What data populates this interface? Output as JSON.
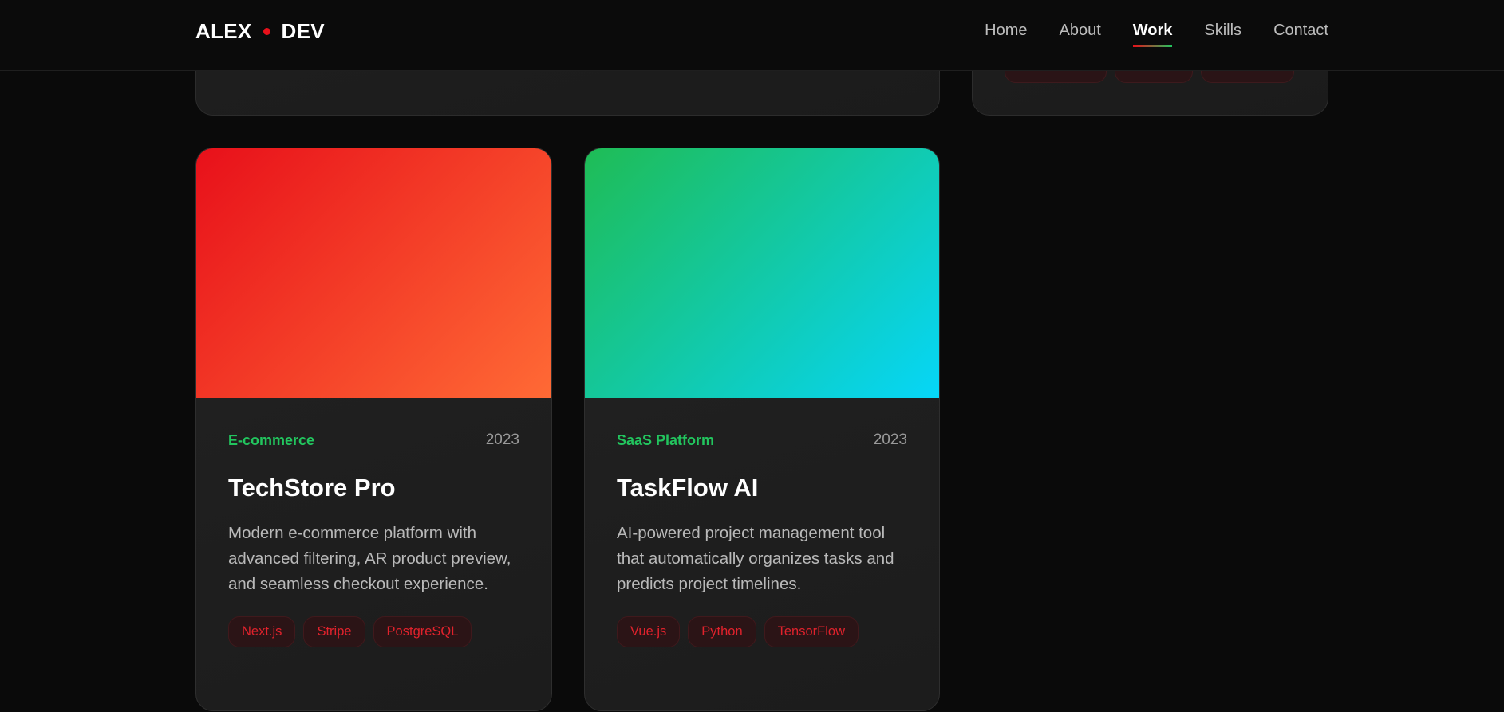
{
  "header": {
    "logo_left": "ALEX",
    "logo_right": "DEV",
    "nav": [
      {
        "label": "Home",
        "active": false
      },
      {
        "label": "About",
        "active": false
      },
      {
        "label": "Work",
        "active": true
      },
      {
        "label": "Skills",
        "active": false
      },
      {
        "label": "Contact",
        "active": false
      }
    ]
  },
  "projects": [
    {
      "category": "E-commerce",
      "year": "2023",
      "title": "TechStore Pro",
      "description": "Modern e-commerce platform with advanced filtering, AR product preview, and seamless checkout experience.",
      "tags": [
        "Next.js",
        "Stripe",
        "PostgreSQL"
      ],
      "gradient": [
        "#e8101a",
        "#ff6a35"
      ]
    },
    {
      "category": "SaaS Platform",
      "year": "2023",
      "title": "TaskFlow AI",
      "description": "AI-powered project management tool that automatically organizes tasks and predicts project timelines.",
      "tags": [
        "Vue.js",
        "Python",
        "TensorFlow"
      ],
      "gradient": [
        "#1fbc55",
        "#06d6f8"
      ]
    }
  ],
  "colors": {
    "background": "#0a0a0a",
    "accent_red": "#e8101a",
    "accent_green": "#22c55e"
  }
}
